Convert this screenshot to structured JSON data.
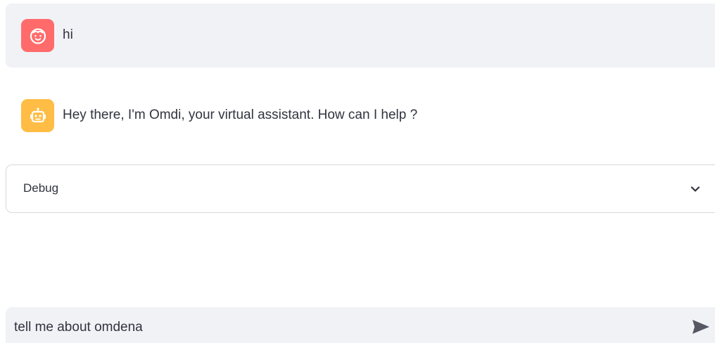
{
  "messages": [
    {
      "role": "user",
      "avatar_icon": "face-icon",
      "avatar_color": "#ff6b6b",
      "text": "hi"
    },
    {
      "role": "assistant",
      "avatar_icon": "robot-icon",
      "avatar_color": "#ffbd45",
      "text": "Hey there, I'm Omdi, your virtual assistant. How can I help ?"
    }
  ],
  "expander": {
    "label": "Debug",
    "icon": "chevron-down-icon"
  },
  "chat_input": {
    "value": "tell me about omdena",
    "send_icon": "send-icon"
  }
}
